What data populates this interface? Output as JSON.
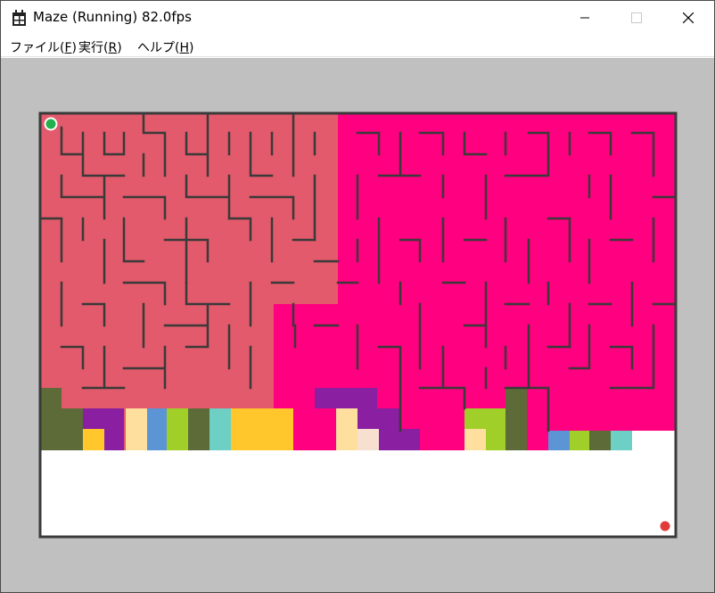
{
  "window": {
    "title": "Maze (Running) 82.0fps"
  },
  "menu": [
    {
      "label": "ファイル",
      "accel": "F"
    },
    {
      "label": "実行",
      "accel": "R"
    },
    {
      "label": "ヘルプ",
      "accel": "H"
    }
  ],
  "icons": {
    "app": "app-icon",
    "minimize": "minimize-icon",
    "maximize": "maximize-icon",
    "close": "close-icon"
  },
  "colors": {
    "client_background": "#c0c0c0",
    "maze_wall": "#3a3a3a",
    "region_salmon": "#e25a6b",
    "region_magenta": "#ff0080",
    "start_marker": "#22b14c",
    "goal_marker": "#e03a3a",
    "unfilled_area": "#ffffff"
  },
  "maze": {
    "status": "Running",
    "fps": "82.0"
  }
}
